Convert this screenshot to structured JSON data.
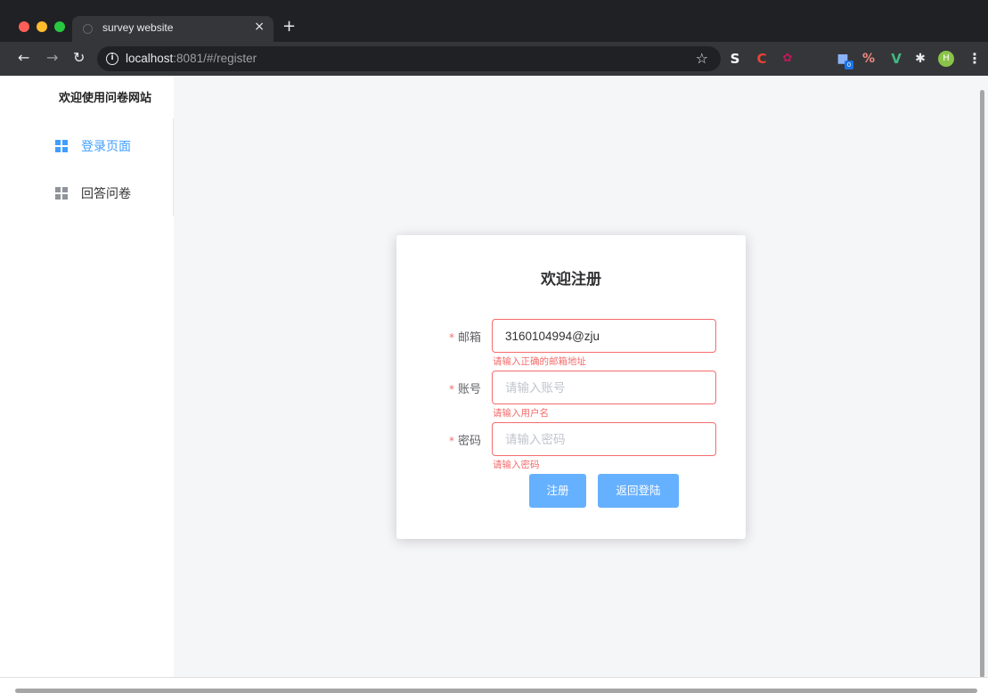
{
  "browser": {
    "tab_title": "survey website",
    "tab_close": "×",
    "new_tab": "+",
    "url_host": "localhost",
    "url_rest": ":8081/#/register",
    "icons": [
      "back-arrow-icon",
      "forward-arrow-icon",
      "reload-icon",
      "info-icon",
      "star-icon",
      "extension-icons",
      "profile-icon",
      "menu-dots-icon"
    ],
    "profile_initial": "H",
    "extension_badge": "0"
  },
  "sidebar": {
    "site_title": "欢迎使用问卷网站",
    "items": [
      {
        "label": "登录页面",
        "icon": "grid-icon",
        "active": true
      },
      {
        "label": "回答问卷",
        "icon": "grid-icon",
        "active": false
      }
    ]
  },
  "register": {
    "title": "欢迎注册",
    "email": {
      "label": "邮箱",
      "value": "3160104994@zju",
      "error": "请输入正确的邮箱地址"
    },
    "account": {
      "label": "账号",
      "placeholder": "请输入账号",
      "error": "请输入用户名"
    },
    "password": {
      "label": "密码",
      "placeholder": "请输入密码",
      "error": "请输入密码"
    },
    "required_mark": "*",
    "register_button": "注册",
    "back_button": "返回登陆"
  },
  "colors": {
    "primary": "#409eff",
    "button": "#66b1ff",
    "error": "#f56c6c",
    "background": "#f5f6f8"
  }
}
